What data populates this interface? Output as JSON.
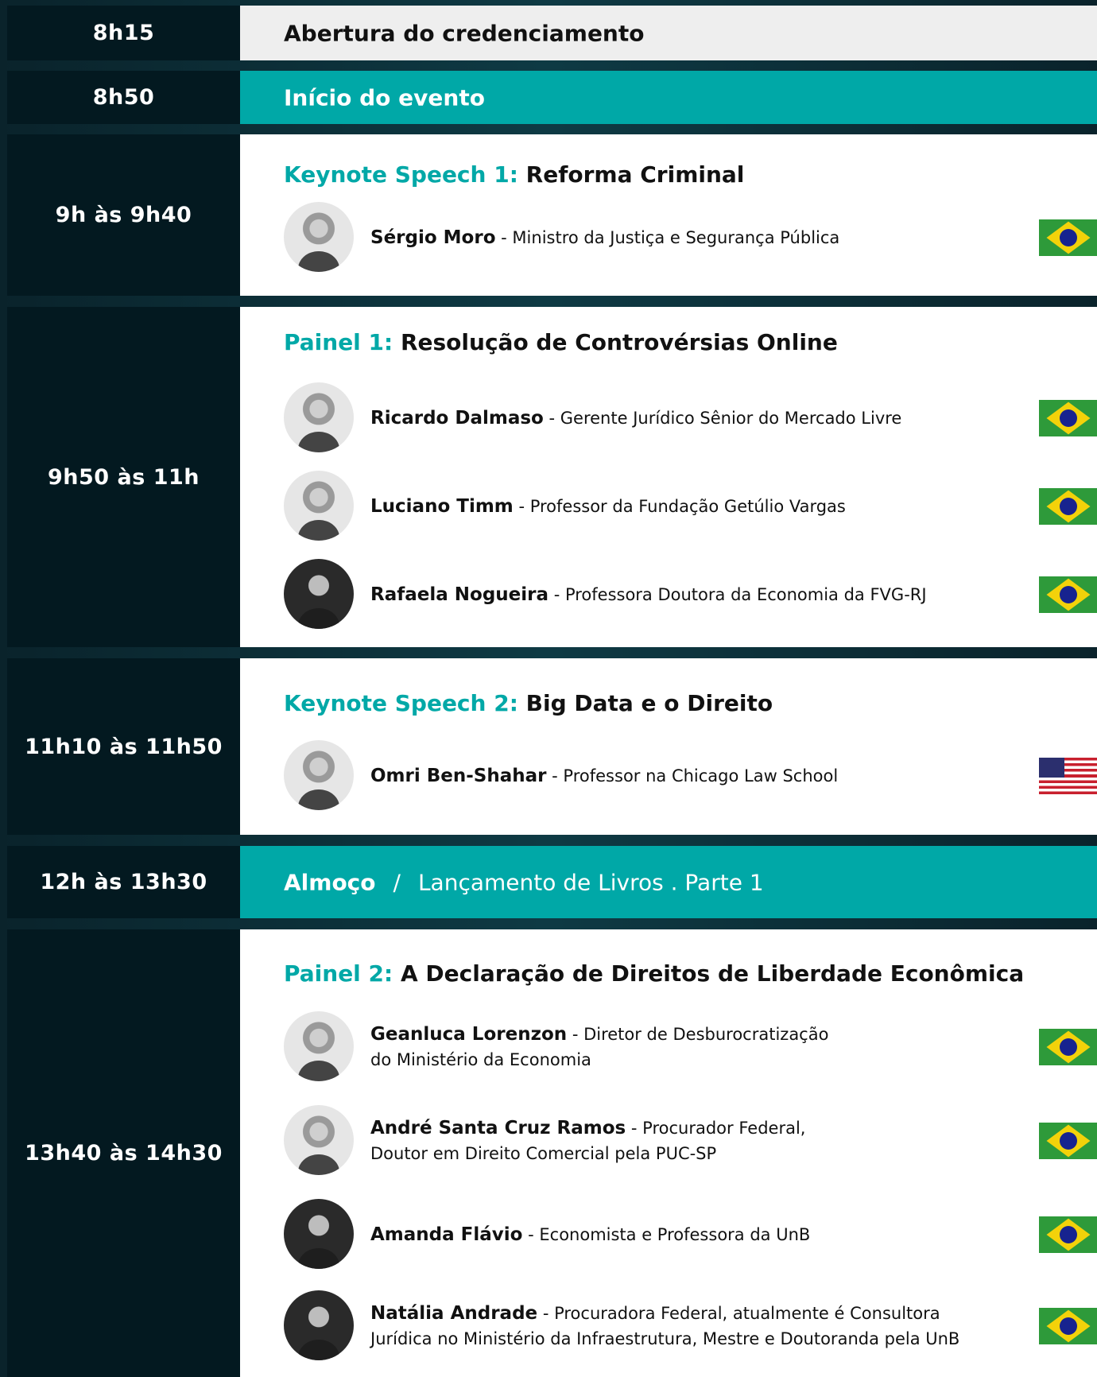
{
  "schedule": [
    {
      "time": "8h15",
      "text": "Abertura do credenciamento"
    },
    {
      "time": "8h50",
      "text": "Início do evento"
    },
    {
      "time": "9h às 9h40",
      "label": "Keynote Speech 1:",
      "title": "Reforma Criminal",
      "speakers": [
        {
          "name": "Sérgio Moro",
          "role": " - Ministro da Justiça e Segurança Pública",
          "flag": "brazil-flag-icon"
        }
      ]
    },
    {
      "time": "9h50 às 11h",
      "label": "Painel 1:",
      "title": "Resolução de Controvérsias Online",
      "speakers": [
        {
          "name": "Ricardo Dalmaso",
          "role": " - Gerente Jurídico Sênior do Mercado Livre",
          "flag": "brazil-flag-icon"
        },
        {
          "name": "Luciano Timm",
          "role": " - Professor da Fundação Getúlio Vargas",
          "flag": "brazil-flag-icon"
        },
        {
          "name": "Rafaela Nogueira",
          "role": " - Professora Doutora da Economia da FVG-RJ",
          "flag": "brazil-flag-icon"
        }
      ]
    },
    {
      "time": "11h10 às 11h50",
      "label": "Keynote Speech 2:",
      "title": "Big Data e o Direito",
      "speakers": [
        {
          "name": "Omri Ben-Shahar",
          "role": " - Professor na Chicago Law School",
          "flag": "usa-flag-icon"
        }
      ]
    },
    {
      "time": "12h às 13h30",
      "text": "Almoço",
      "separator": "/",
      "subtext": "Lançamento de Livros . Parte 1"
    },
    {
      "time": "13h40 às 14h30",
      "label": "Painel 2:",
      "title": "A Declaração de Direitos de Liberdade Econômica",
      "speakers": [
        {
          "name": "Geanluca Lorenzon",
          "role": " - Diretor de Desburocratização",
          "role2": "do Ministério da Economia",
          "flag": "brazil-flag-icon"
        },
        {
          "name": "André Santa Cruz Ramos",
          "role": " - Procurador Federal,",
          "role2": "Doutor em Direito Comercial pela PUC-SP",
          "flag": "brazil-flag-icon"
        },
        {
          "name": "Amanda Flávio",
          "role": " - Economista e Professora da UnB",
          "flag": "brazil-flag-icon"
        },
        {
          "name": "Natália Andrade",
          "role": " - Procuradora Federal, atualmente é Consultora",
          "role2": "Jurídica no Ministério da Infraestrutura, Mestre e Doutoranda pela UnB",
          "flag": "brazil-flag-icon"
        }
      ]
    }
  ],
  "colors": {
    "accent": "#00a8a7",
    "time_bg": "#031920",
    "row_gray": "#eeeeee"
  }
}
